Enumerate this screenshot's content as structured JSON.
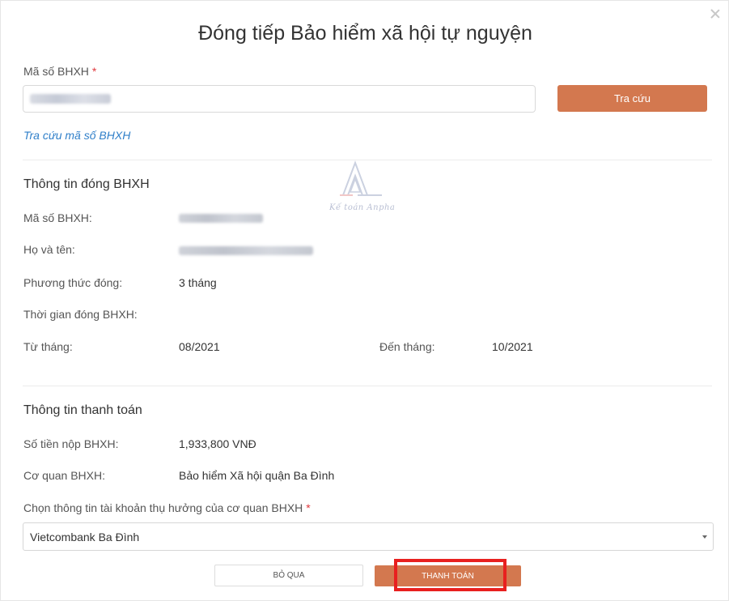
{
  "dialog": {
    "title": "Đóng tiếp Bảo hiểm xã hội tự nguyện"
  },
  "lookup": {
    "label": "Mã số BHXH",
    "required_mark": "*",
    "search_button": "Tra cứu",
    "link": "Tra cứu mã số BHXH"
  },
  "contribution": {
    "section_title": "Thông tin đóng BHXH",
    "id_label": "Mã số BHXH:",
    "name_label": "Họ và tên:",
    "method_label": "Phương thức đóng:",
    "method_value": "3 tháng",
    "period_label": "Thời gian đóng BHXH:",
    "from_label": "Từ tháng:",
    "from_value": "08/2021",
    "to_label": "Đến tháng:",
    "to_value": "10/2021"
  },
  "payment": {
    "section_title": "Thông tin thanh toán",
    "amount_label": "Số tiền nộp BHXH:",
    "amount_value": "1,933,800 VNĐ",
    "agency_label": "Cơ quan BHXH:",
    "agency_value": "Bảo hiểm Xã hội quận Ba Đình",
    "account_label": "Chọn thông tin tài khoản thụ hưởng của cơ quan BHXH",
    "account_selected": "Vietcombank Ba Đình"
  },
  "actions": {
    "skip": "BỎ QUA",
    "pay": "THANH TOÁN"
  },
  "watermark": {
    "text": "Kế toán Anpha"
  },
  "colors": {
    "accent": "#d3784f",
    "link": "#2f7fc9",
    "required": "#e0393e",
    "highlight": "#e8201f"
  }
}
